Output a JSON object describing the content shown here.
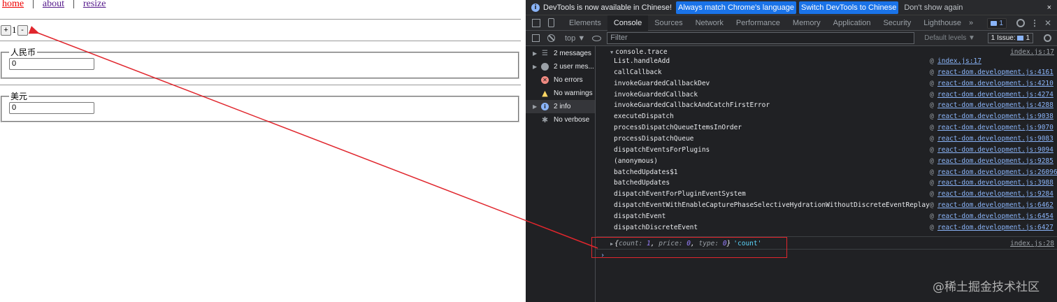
{
  "app": {
    "nav": {
      "home": "home",
      "sep1": "|",
      "about": "about",
      "sep2": "|",
      "resize": "resize"
    },
    "counter": {
      "plus": "+",
      "value": "1",
      "minus": "-"
    },
    "rmb": {
      "legend": "人民币",
      "value": "0"
    },
    "usd": {
      "legend": "美元",
      "value": "0"
    }
  },
  "devtools": {
    "infobar": {
      "message": "DevTools is now available in Chinese!",
      "btn_match": "Always match Chrome's language",
      "btn_switch": "Switch DevTools to Chinese",
      "dismiss": "Don't show again",
      "close": "×"
    },
    "tabs": [
      "Elements",
      "Console",
      "Sources",
      "Network",
      "Performance",
      "Memory",
      "Application",
      "Security",
      "Lighthouse"
    ],
    "more": "»",
    "badge_count": "1",
    "toolbar": {
      "context": "top ▼",
      "filter_placeholder": "Filter",
      "levels": "Default levels ▼",
      "issue": "1 Issue:",
      "issue_count": "1"
    },
    "sidebar": [
      {
        "label": "2 messages",
        "icon": "list-icon"
      },
      {
        "label": "2 user mes...",
        "icon": "user-icon"
      },
      {
        "label": "No errors",
        "icon": "error-icon"
      },
      {
        "label": "No warnings",
        "icon": "warning-icon"
      },
      {
        "label": "2 info",
        "icon": "info-icon"
      },
      {
        "label": "No verbose",
        "icon": "verbose-icon"
      }
    ],
    "console": {
      "trace_title": "console.trace",
      "trace_source": "index.js:17",
      "frames": [
        {
          "fn": "List.handleAdd",
          "loc": "index.js:17"
        },
        {
          "fn": "callCallback",
          "loc": "react-dom.development.js:4161"
        },
        {
          "fn": "invokeGuardedCallbackDev",
          "loc": "react-dom.development.js:4210"
        },
        {
          "fn": "invokeGuardedCallback",
          "loc": "react-dom.development.js:4274"
        },
        {
          "fn": "invokeGuardedCallbackAndCatchFirstError",
          "loc": "react-dom.development.js:4288"
        },
        {
          "fn": "executeDispatch",
          "loc": "react-dom.development.js:9038"
        },
        {
          "fn": "processDispatchQueueItemsInOrder",
          "loc": "react-dom.development.js:9070"
        },
        {
          "fn": "processDispatchQueue",
          "loc": "react-dom.development.js:9083"
        },
        {
          "fn": "dispatchEventsForPlugins",
          "loc": "react-dom.development.js:9094"
        },
        {
          "fn": "(anonymous)",
          "loc": "react-dom.development.js:9285"
        },
        {
          "fn": "batchedUpdates$1",
          "loc": "react-dom.development.js:26096"
        },
        {
          "fn": "batchedUpdates",
          "loc": "react-dom.development.js:3988"
        },
        {
          "fn": "dispatchEventForPluginEventSystem",
          "loc": "react-dom.development.js:9284"
        },
        {
          "fn": "dispatchEventWithEnableCapturePhaseSelectiveHydrationWithoutDiscreteEventReplay",
          "loc": "react-dom.development.js:6462"
        },
        {
          "fn": "dispatchEvent",
          "loc": "react-dom.development.js:6454"
        },
        {
          "fn": "dispatchDiscreteEvent",
          "loc": "react-dom.development.js:6427"
        }
      ],
      "at": "@",
      "obj": {
        "open": "{",
        "k1": "count:",
        "v1": "1",
        "c1": ",",
        "k2": "price:",
        "v2": "0",
        "c2": ",",
        "k3": "type:",
        "v3": "0",
        "close": "}",
        "str": "'count'"
      },
      "obj_source": "index.js:28",
      "prompt": "›"
    }
  },
  "annotation": {
    "color": "#e0262d"
  },
  "watermark": "@稀土掘金技术社区"
}
